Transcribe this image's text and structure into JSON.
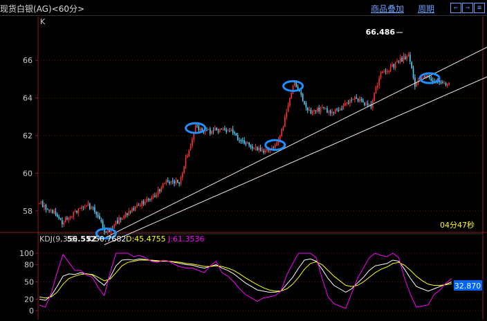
{
  "header": {
    "title": "现货白银(AG)<60分>",
    "overlay_label": "商品叠加",
    "period_label": "周期",
    "nav_left": "⇐",
    "nav_right": "⇒",
    "nav_menu": "≡"
  },
  "main": {
    "label": "K",
    "countdown": "04分47秒"
  },
  "colors": {
    "background": "#000000",
    "up": "#ff3030",
    "down": "#54d4ff",
    "axis": "#8a1c1c",
    "k_line": "#ffffff",
    "d_line": "#ffff00",
    "j_line": "#ff00ff",
    "ellipse": "#1e8fff"
  },
  "chart_data": [
    {
      "type": "candlestick",
      "yticks": [
        58,
        60,
        62,
        64,
        66
      ],
      "ylim": [
        56.0,
        67.4
      ],
      "annotations": [
        {
          "text": "56.552",
          "value": 56.552,
          "index": 41
        },
        {
          "text": "66.486",
          "value": 66.486,
          "index": 223
        }
      ],
      "channel_lines": [
        {
          "from": [
            40,
            56.55
          ],
          "to": [
            280,
            66.9
          ]
        },
        {
          "from": [
            40,
            56.2
          ],
          "to": [
            280,
            65.3
          ]
        }
      ],
      "highlights": [
        41,
        96,
        145,
        156,
        240
      ],
      "series": [
        {
          "name": "price",
          "knots": [
            [
              0,
              58.4
            ],
            [
              8,
              58.0
            ],
            [
              14,
              57.4
            ],
            [
              22,
              57.9
            ],
            [
              30,
              58.3
            ],
            [
              36,
              57.8
            ],
            [
              41,
              56.8
            ],
            [
              50,
              57.6
            ],
            [
              60,
              58.2
            ],
            [
              70,
              58.8
            ],
            [
              78,
              59.5
            ],
            [
              86,
              59.5
            ],
            [
              92,
              61.3
            ],
            [
              96,
              62.4
            ],
            [
              100,
              62.3
            ],
            [
              104,
              62.2
            ],
            [
              112,
              62.4
            ],
            [
              118,
              62.2
            ],
            [
              124,
              61.7
            ],
            [
              132,
              61.4
            ],
            [
              138,
              61.2
            ],
            [
              145,
              61.5
            ],
            [
              150,
              62.5
            ],
            [
              154,
              64.1
            ],
            [
              157,
              64.9
            ],
            [
              160,
              64.3
            ],
            [
              166,
              63.3
            ],
            [
              172,
              63.4
            ],
            [
              180,
              63.3
            ],
            [
              186,
              63.5
            ],
            [
              192,
              64.0
            ],
            [
              198,
              63.8
            ],
            [
              204,
              63.6
            ],
            [
              210,
              65.3
            ],
            [
              216,
              65.6
            ],
            [
              222,
              66.0
            ],
            [
              227,
              66.3
            ],
            [
              231,
              64.6
            ],
            [
              236,
              65.2
            ],
            [
              244,
              64.9
            ],
            [
              252,
              64.8
            ]
          ]
        }
      ]
    },
    {
      "type": "line",
      "title": "KDJ(9,3,3)",
      "yticks": [
        0,
        20,
        50,
        80,
        100
      ],
      "ylim": [
        0,
        100
      ],
      "current_value": "32.870",
      "series": [
        {
          "name": "K",
          "value_label": "K:50.7682",
          "values": [
            20,
            18,
            26,
            42,
            60,
            64,
            63,
            66,
            64,
            62,
            52,
            44,
            58,
            78,
            88,
            89,
            88,
            90,
            89,
            87,
            86,
            86,
            86,
            84,
            82,
            80,
            79,
            76,
            74,
            77,
            80,
            74,
            70,
            64,
            56,
            48,
            42,
            36,
            34,
            32,
            32,
            34,
            46,
            58,
            74,
            88,
            90,
            86,
            72,
            56,
            44,
            38,
            32,
            38,
            48,
            58,
            70,
            78,
            80,
            82,
            88,
            86,
            72,
            56,
            42,
            38,
            34,
            38,
            42,
            46,
            50
          ]
        },
        {
          "name": "D",
          "value_label": "D:45.4755",
          "values": [
            24,
            22,
            24,
            32,
            46,
            56,
            60,
            63,
            64,
            63,
            58,
            52,
            55,
            66,
            78,
            84,
            86,
            88,
            88,
            88,
            87,
            86,
            86,
            85,
            84,
            82,
            81,
            79,
            77,
            77,
            78,
            77,
            74,
            70,
            64,
            57,
            51,
            45,
            40,
            36,
            34,
            34,
            38,
            46,
            58,
            72,
            82,
            85,
            80,
            70,
            60,
            52,
            44,
            42,
            44,
            50,
            58,
            66,
            72,
            76,
            82,
            84,
            79,
            70,
            60,
            52,
            46,
            44,
            44,
            45,
            47
          ]
        },
        {
          "name": "J",
          "value_label": "J:61.3536",
          "values": [
            10,
            6,
            30,
            66,
            98,
            84,
            70,
            70,
            62,
            58,
            40,
            26,
            66,
            100,
            100,
            100,
            94,
            96,
            92,
            86,
            84,
            88,
            86,
            80,
            76,
            74,
            74,
            70,
            66,
            78,
            86,
            66,
            60,
            50,
            38,
            28,
            22,
            16,
            22,
            24,
            26,
            34,
            62,
            82,
            100,
            100,
            100,
            92,
            56,
            24,
            12,
            8,
            4,
            30,
            56,
            74,
            92,
            100,
            96,
            94,
            100,
            92,
            56,
            28,
            6,
            8,
            10,
            28,
            36,
            48,
            56
          ]
        }
      ]
    }
  ]
}
